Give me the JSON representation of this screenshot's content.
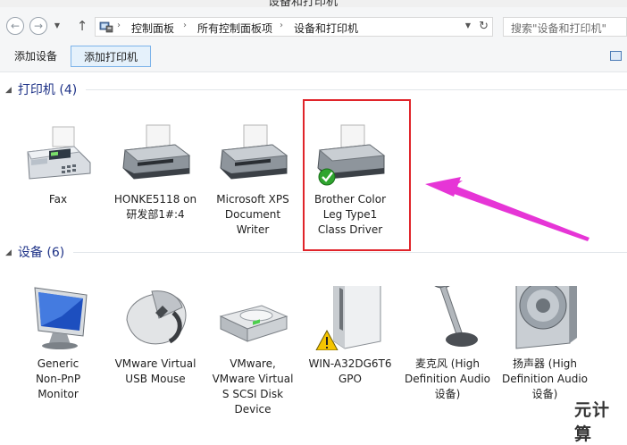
{
  "window": {
    "title": "设备和打印机"
  },
  "nav": {
    "back_icon": "arrow-left-icon",
    "forward_icon": "arrow-right-icon",
    "up_icon": "arrow-up-icon"
  },
  "address": {
    "crumbs": [
      "控制面板",
      "所有控制面板项",
      "设备和打印机"
    ],
    "separator": "›"
  },
  "search": {
    "placeholder": "搜索\"设备和打印机\""
  },
  "toolbar": {
    "add_device": "添加设备",
    "add_printer": "添加打印机"
  },
  "printers": {
    "header": "打印机 (4)",
    "items": [
      {
        "label": "Fax",
        "icon": "fax-icon"
      },
      {
        "label": "HONKE5118 on\n研发部1#:4",
        "icon": "printer-icon"
      },
      {
        "label": "Microsoft XPS\nDocument\nWriter",
        "icon": "printer-icon"
      },
      {
        "label": "Brother Color\nLeg Type1\nClass Driver",
        "icon": "printer-default-icon",
        "default": true
      }
    ]
  },
  "devices": {
    "header": "设备 (6)",
    "items": [
      {
        "label": "Generic\nNon-PnP\nMonitor",
        "icon": "monitor-icon"
      },
      {
        "label": "VMware Virtual\nUSB Mouse",
        "icon": "mouse-icon"
      },
      {
        "label": "VMware,\nVMware Virtual\nS SCSI Disk\nDevice",
        "icon": "hard-disk-icon"
      },
      {
        "label": "WIN-A32DG6T6\nGPO",
        "icon": "computer-warning-icon"
      },
      {
        "label": "麦克风 (High\nDefinition Audio\n设备)",
        "icon": "microphone-icon"
      },
      {
        "label": "扬声器 (High\nDefinition Audio\n设备)",
        "icon": "speaker-icon"
      }
    ]
  },
  "annotation": {
    "highlight_color": "#e0242a",
    "arrow_color": "#e635d6"
  },
  "watermark": "元计算"
}
